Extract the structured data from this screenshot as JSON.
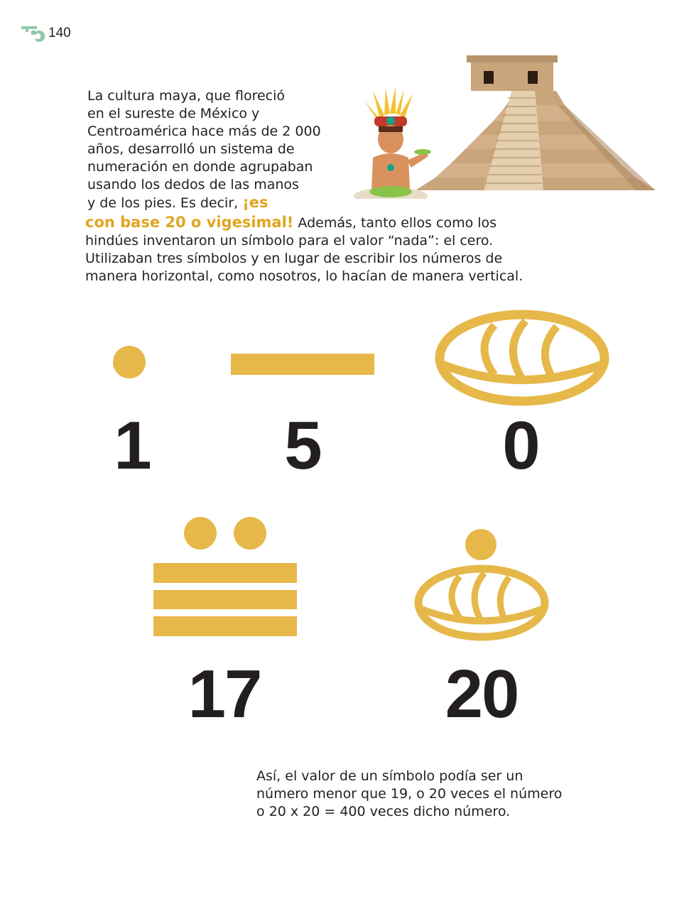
{
  "header": {
    "page_number": "140",
    "icon": "maya-fret-icon"
  },
  "intro": {
    "lines": [
      "La cultura maya, que floreció",
      "en el sureste de México y",
      "Centroamérica hace más de 2 000",
      "años, desarrolló un sistema de",
      "numeración en donde agrupaban",
      "usando los dedos de las manos"
    ],
    "line7_prefix": "y de los pies. Es decir, ",
    "highlight_part1": "¡es",
    "highlight_part2": "con base 20 o vigesimal!",
    "line8_suffix": " Además, tanto ellos como los",
    "lines_after": [
      "hindúes inventaron un símbolo para el valor “nada”: el cero.",
      "Utilizaban tres símbolos y en lugar de escribir los números de",
      "manera horizontal, como nosotros, lo hacían de manera vertical."
    ]
  },
  "illustration": {
    "name": "mayan-pyramid-and-priest"
  },
  "symbols": {
    "one": {
      "glyph": "dot",
      "label": "1"
    },
    "five": {
      "glyph": "bar",
      "label": "5"
    },
    "zero": {
      "glyph": "shell",
      "label": "0"
    },
    "seventeen": {
      "glyph": "two-dots-three-bars",
      "label": "17"
    },
    "twenty": {
      "glyph": "dot-over-shell",
      "label": "20"
    }
  },
  "closing": {
    "lines": [
      "Así, el valor de un símbolo podía ser un",
      "número menor que 19, o 20 veces el número",
      "o 20 x 20 = 400 veces dicho número."
    ]
  },
  "colors": {
    "glyph": "#e6b84a",
    "highlight": "#e0a521",
    "text": "#231f20",
    "folio_icon": "#8fc9a8"
  }
}
